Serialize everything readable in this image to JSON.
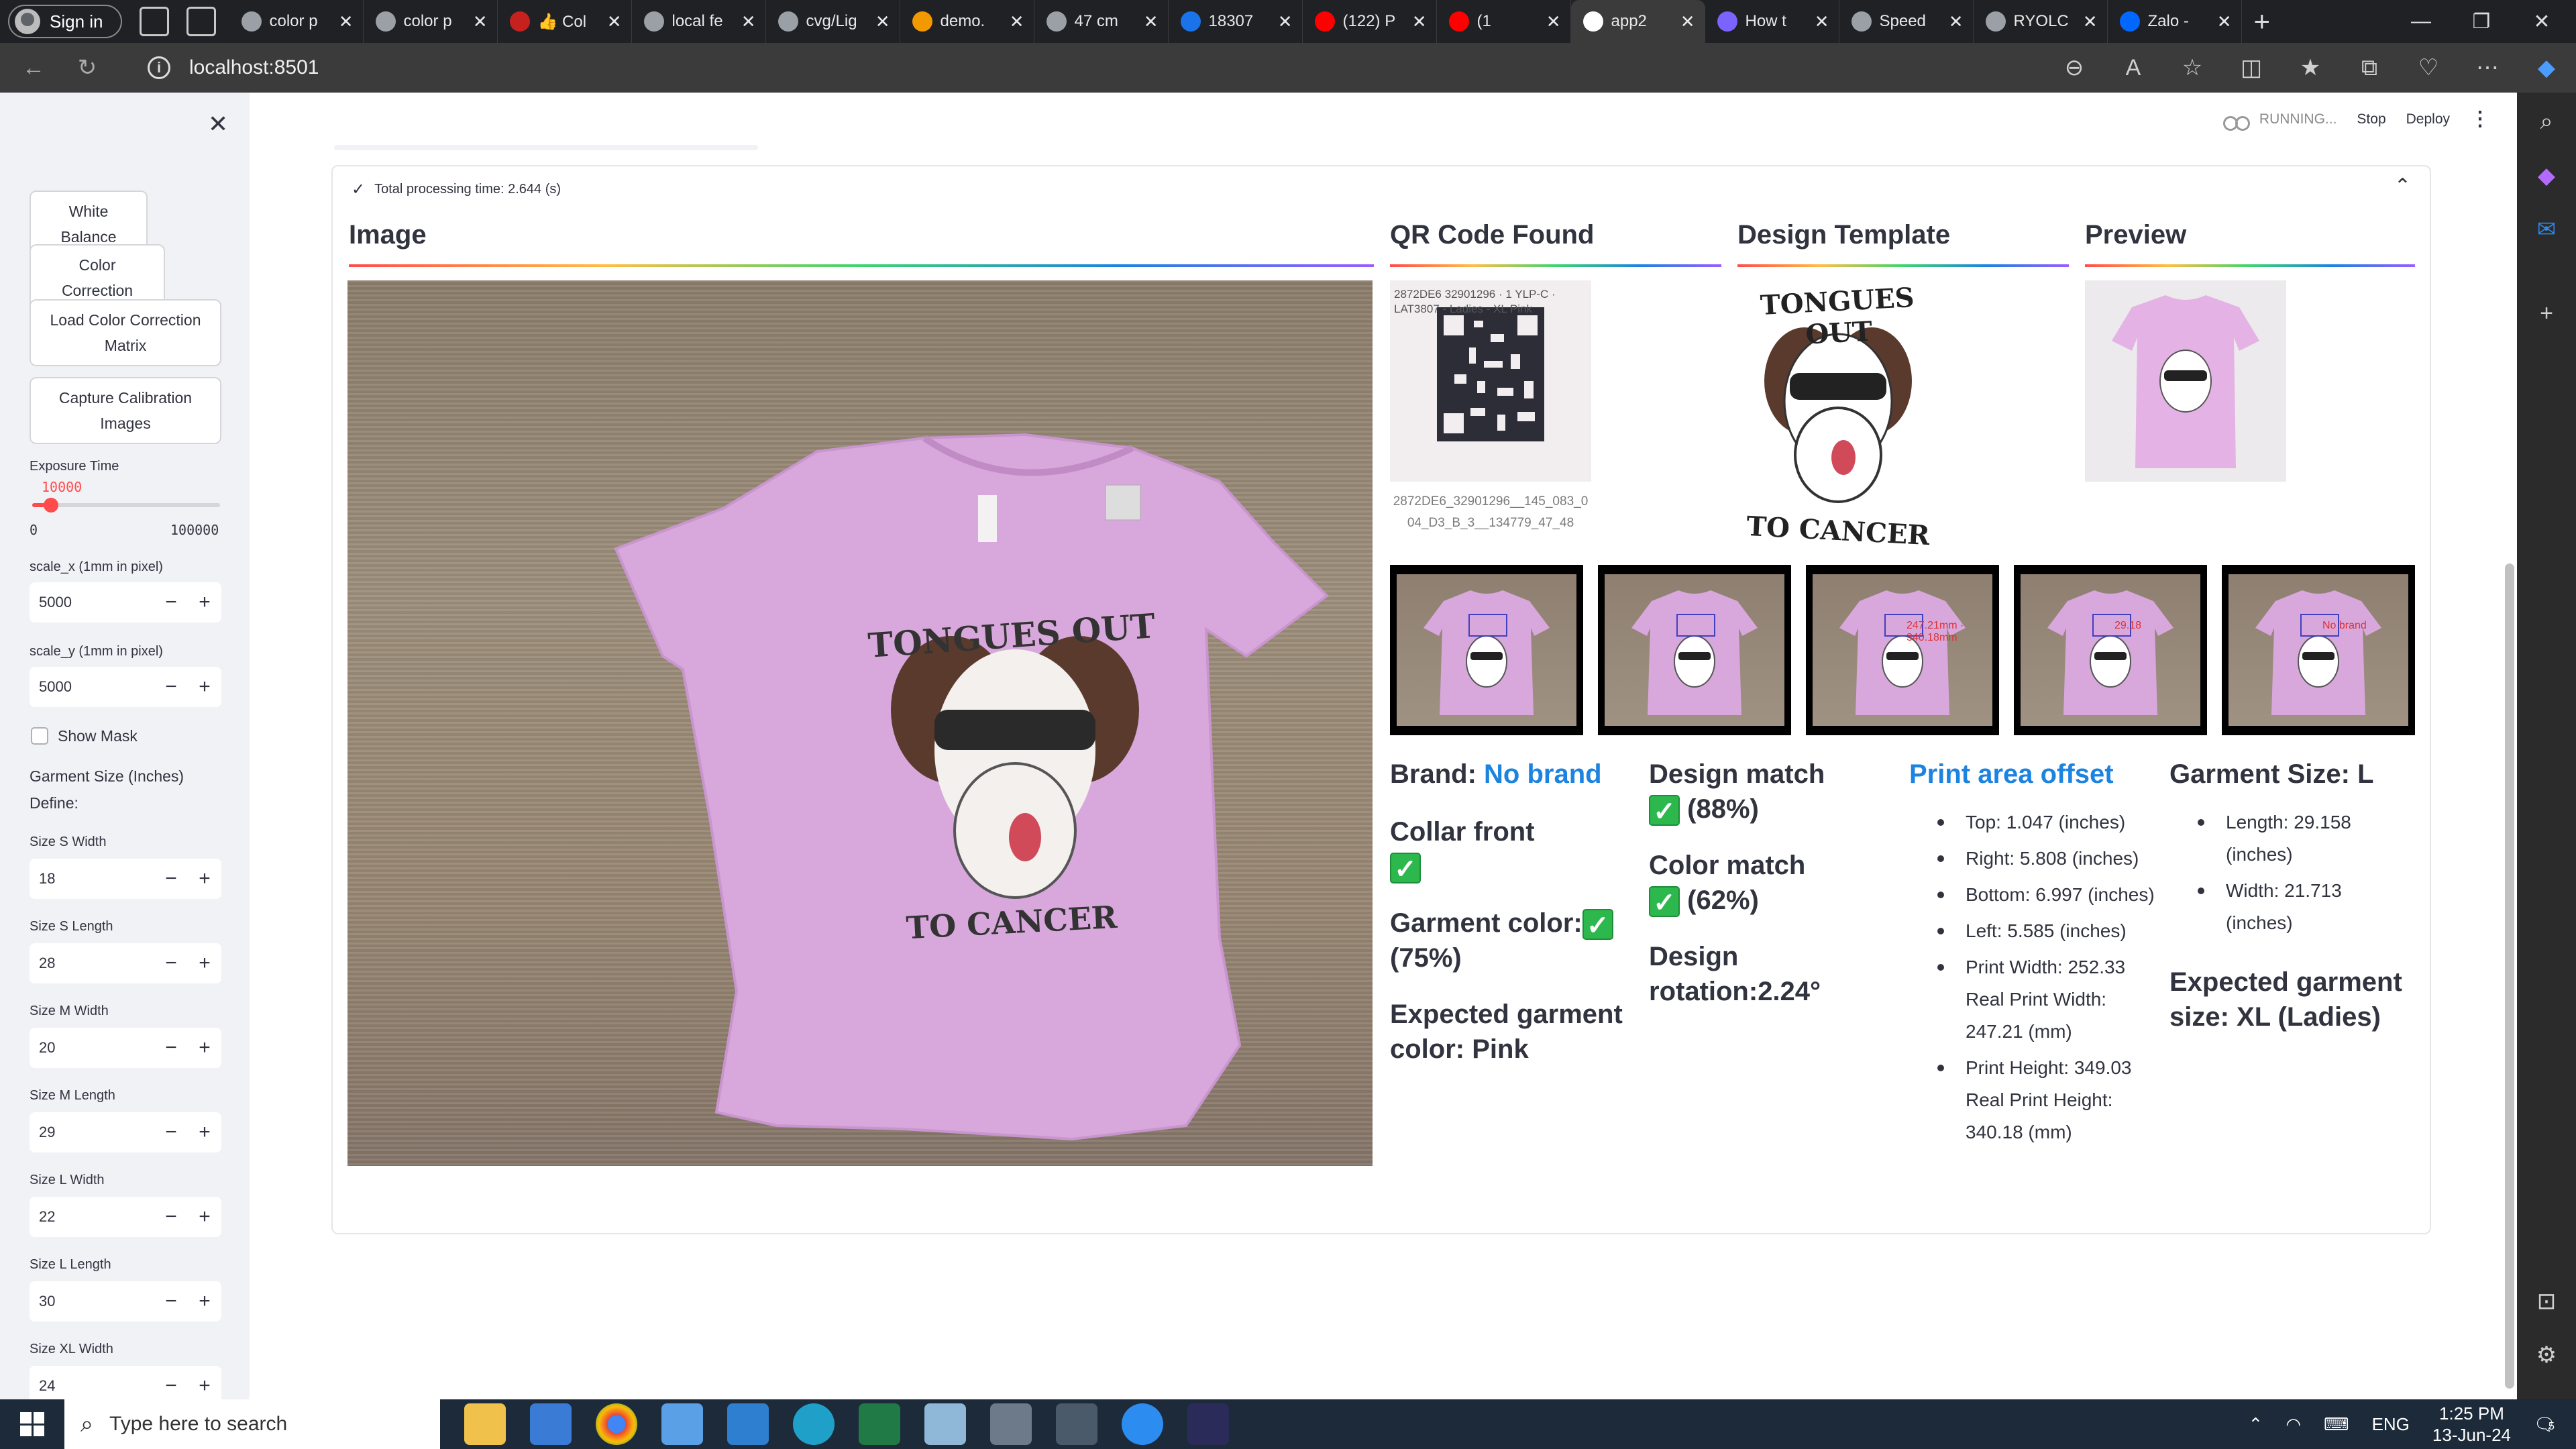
{
  "browser": {
    "signin": "Sign in",
    "tabs": [
      {
        "label": "color p",
        "color": "#9aa0a6"
      },
      {
        "label": "color p",
        "color": "#9aa0a6"
      },
      {
        "label": "👍 Col",
        "color": "#c5221f"
      },
      {
        "label": "local fe",
        "color": "#9aa0a6"
      },
      {
        "label": "cvg/Lig",
        "color": "#9aa0a6"
      },
      {
        "label": "demo.",
        "color": "#f29900"
      },
      {
        "label": "47 cm",
        "color": "#9aa0a6"
      },
      {
        "label": "18307",
        "color": "#1a73e8"
      },
      {
        "label": "(122) P",
        "color": "#ff0000"
      },
      {
        "label": "(1",
        "color": "#ff0000"
      },
      {
        "label": "app2",
        "color": "#ffffff"
      },
      {
        "label": "How t",
        "color": "#7a63ff"
      },
      {
        "label": "Speed",
        "color": "#9aa0a6"
      },
      {
        "label": "RYOLC",
        "color": "#9aa0a6"
      },
      {
        "label": "Zalo -",
        "color": "#0068ff"
      }
    ],
    "url": "localhost:8501"
  },
  "sidebar": {
    "buttons": {
      "white_balance": "White Balance",
      "color_correction": "Color Correction",
      "load_ccm": "Load Color Correction Matrix",
      "capture": "Capture Calibration Images"
    },
    "exposure": {
      "label": "Exposure Time",
      "value": "10000",
      "min": "0",
      "max": "100000",
      "fraction": 0.1
    },
    "scale_x": {
      "label": "scale_x (1mm in pixel)",
      "value": "5000"
    },
    "scale_y": {
      "label": "scale_y (1mm in pixel)",
      "value": "5000"
    },
    "show_mask": "Show Mask",
    "garment_size_label": "Garment Size (Inches)",
    "define_label": "Define:",
    "sizes": [
      {
        "label": "Size S Width",
        "value": "18"
      },
      {
        "label": "Size S Length",
        "value": "28"
      },
      {
        "label": "Size M Width",
        "value": "20"
      },
      {
        "label": "Size M Length",
        "value": "29"
      },
      {
        "label": "Size L Width",
        "value": "22"
      },
      {
        "label": "Size L Length",
        "value": "30"
      },
      {
        "label": "Size XL Width",
        "value": "24"
      }
    ]
  },
  "status": {
    "running": "RUNNING...",
    "stop": "Stop",
    "deploy": "Deploy"
  },
  "result": {
    "processing_time": "Total processing time: 2.644 (s)",
    "headers": {
      "image": "Image",
      "qr": "QR Code Found",
      "template": "Design Template",
      "preview": "Preview"
    },
    "qr_caption": "2872DE6_32901296__145_083_004_D3_B_3__134779_47_48",
    "qr_print": "2872DE6 32901296 · 1 YLP-C · LAT3807 - Ladies - XL Pink",
    "design_text_top": "TONGUES OUT",
    "design_text_bottom": "TO CANCER",
    "thumb_labels": [
      "",
      "",
      "247.21mm · 340.18mm",
      "29.18",
      "No brand"
    ],
    "brand_label": "Brand:",
    "brand_value": "No brand",
    "collar_front": "Collar front",
    "garment_color": "Garment color:",
    "garment_color_pct": "(75%)",
    "expected_color": "Expected garment color: Pink",
    "design_match": "Design match",
    "design_match_pct": "(88%)",
    "color_match": "Color match",
    "color_match_pct": "(62%)",
    "design_rotation": "Design rotation:2.24°",
    "print_offset_title": "Print area offset",
    "print_offsets": [
      "Top: 1.047 (inches)",
      "Right: 5.808 (inches)",
      "Bottom: 6.997 (inches)",
      "Left: 5.585 (inches)",
      "Print Width: 252.33 Real Print Width: 247.21 (mm)",
      "Print Height: 349.03 Real Print Height: 340.18 (mm)"
    ],
    "garment_size_title": "Garment Size: L",
    "garment_dims": [
      "Length: 29.158 (inches)",
      "Width: 21.713 (inches)"
    ],
    "expected_size": "Expected garment size: XL (Ladies)"
  },
  "taskbar": {
    "search_placeholder": "Type here to search",
    "lang": "ENG",
    "time": "1:25 PM",
    "date": "13-Jun-24",
    "notif_count": "5"
  },
  "colors": {
    "accent": "#ff4b4b",
    "link": "#1c83e1",
    "ok": "#2db84d",
    "shirt": "#d9a9dd"
  }
}
